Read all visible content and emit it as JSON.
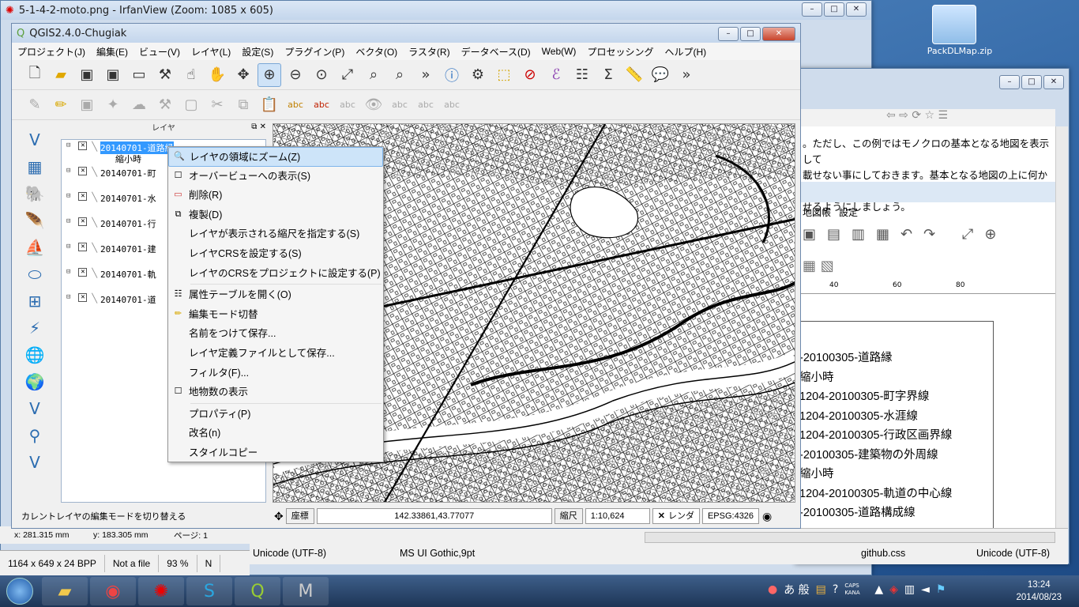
{
  "irfanview": {
    "title": "5-1-4-2-moto.png - IrfanView (Zoom: 1085 x 605)",
    "status": [
      "1164 x 649 x 24 BPP",
      "Not a file",
      "93 %",
      "N"
    ],
    "coords": [
      "x: 281.315 mm",
      "y: 183.305 mm",
      "ページ: 1"
    ]
  },
  "desktop": {
    "icon_label": "PackDLMap.zip"
  },
  "right_app": {
    "text_lines": [
      "。ただし、この例ではモノクロの基本となる地図を表示して",
      "載せない事にしておきます。基本となる地図の上に何かしら",
      "せるようにしましょう。"
    ],
    "menu": [
      "地図帳",
      "設定"
    ],
    "ruler": [
      "40",
      "60",
      "80"
    ],
    "legend": [
      "-20100305-道路縁",
      "縮小時",
      "1204-20100305-町字界線",
      "1204-20100305-水涯線",
      "1204-20100305-行政区画界線",
      "-20100305-建築物の外周線",
      "縮小時",
      "1204-20100305-軌道の中心線",
      "-20100305-道路構成線"
    ],
    "status": [
      "Unicode (UTF-8)",
      "MS UI Gothic,9pt",
      "github.css",
      "Unicode (UTF-8)"
    ]
  },
  "qgis": {
    "title": "QGIS2.4.0-Chugiak",
    "menu": [
      "プロジェクト(J)",
      "編集(E)",
      "ビュー(V)",
      "レイヤ(L)",
      "設定(S)",
      "プラグイン(P)",
      "ベクタ(O)",
      "ラスタ(R)",
      "データベース(D)",
      "Web(W)",
      "プロセッシング",
      "ヘルプ(H)"
    ],
    "panel_title": "レイヤ",
    "layers": [
      {
        "name": "20140701-道路縁",
        "sub": "縮小時"
      },
      {
        "name": "20140701-町"
      },
      {
        "name": "20140701-水"
      },
      {
        "name": "20140701-行"
      },
      {
        "name": "20140701-建"
      },
      {
        "name": "20140701-軌"
      },
      {
        "name": "20140701-道"
      }
    ],
    "status_msg": "カレントレイヤの編集モードを切り替える",
    "coord_label": "座標",
    "coord_value": "142.33861,43.77077",
    "scale_label": "縮尺",
    "scale_value": "1:10,624",
    "render_label": "レンダ",
    "crs": "EPSG:4326"
  },
  "context_menu": [
    {
      "label": "レイヤの領域にズーム(Z)",
      "icon": "zoom-icon",
      "hl": true
    },
    {
      "label": "オーバービューへの表示(S)",
      "icon": "checkbox-icon"
    },
    {
      "label": "削除(R)",
      "icon": "remove-icon"
    },
    {
      "label": "複製(D)",
      "icon": "duplicate-icon"
    },
    {
      "label": "レイヤが表示される縮尺を指定する(S)"
    },
    {
      "label": "レイヤCRSを設定する(S)"
    },
    {
      "label": "レイヤのCRSをプロジェクトに設定する(P)"
    },
    {
      "sep": true
    },
    {
      "label": "属性テーブルを開く(O)",
      "icon": "table-icon"
    },
    {
      "label": "編集モード切替",
      "icon": "pencil-icon"
    },
    {
      "label": "名前をつけて保存..."
    },
    {
      "label": "レイヤ定義ファイルとして保存..."
    },
    {
      "label": "フィルタ(F)..."
    },
    {
      "label": "地物数の表示",
      "icon": "checkbox-icon"
    },
    {
      "sep": true
    },
    {
      "label": "プロパティ(P)"
    },
    {
      "label": "改名(n)"
    },
    {
      "label": "スタイルコピー"
    }
  ],
  "taskbar": {
    "time": "13:24",
    "date": "2014/08/23",
    "ime": "あ 般",
    "caps": "CAPS",
    "kana": "KANA"
  }
}
